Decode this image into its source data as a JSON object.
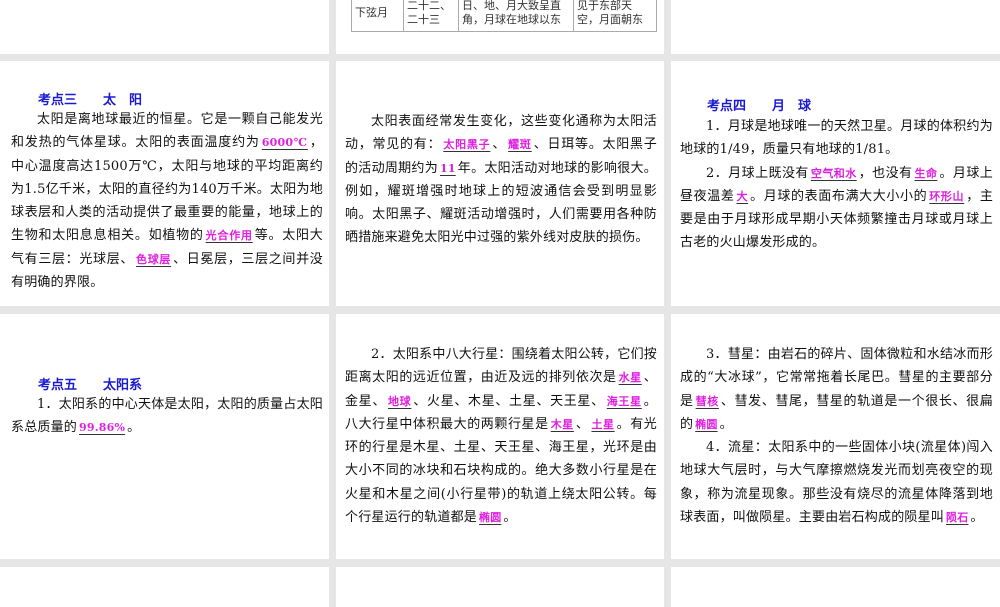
{
  "table_row": {
    "cells": [
      "下弦月",
      "二十二、\n二十三",
      "日、地、月大致呈直角，月球在地球以东",
      "见于东部天空，月面朝东"
    ]
  },
  "slides": {
    "sun": {
      "heading": [
        "考点三",
        "太　阳"
      ],
      "paragraphs": [
        [
          {
            "t": "太阳是离地球最近的恒星。它是一颗自己能发光和发热的气体星球。太阳的表面温度约为"
          },
          {
            "t": "6000℃",
            "hl": true
          },
          {
            "t": "，中心温度高达1500万℃，太阳与地球的平均距离约为1.5亿千米，太阳的直径约为140万千米。太阳为地球表层和人类的活动提供了最重要的能量，地球上的生物和太阳息息相关。如植物的"
          },
          {
            "t": "光合作用",
            "hl": true
          },
          {
            "t": "等。太阳大气有三层：光球层、"
          },
          {
            "t": "色球层",
            "hl": true
          },
          {
            "t": "、日冕层，三层之间并没有明确的界限。"
          }
        ]
      ]
    },
    "solar_activity": {
      "paragraphs": [
        [
          {
            "t": "太阳表面经常发生变化，这些变化通称为太阳活动，常见的有："
          },
          {
            "t": "太阳黑子",
            "hl": true
          },
          {
            "t": "、"
          },
          {
            "t": "耀斑",
            "hl": true
          },
          {
            "t": "、日珥等。太阳黑子的活动周期约为"
          },
          {
            "t": "11",
            "hl": true
          },
          {
            "t": "年。太阳活动对地球的影响很大。例如，耀斑增强时地球上的短波通信会受到明显影响。太阳黑子、耀斑活动增强时，人们需要用各种防晒措施来避免太阳光中过强的紫外线对皮肤的损伤。"
          }
        ]
      ]
    },
    "moon": {
      "heading": [
        "考点四",
        "月　球"
      ],
      "paragraphs": [
        [
          {
            "t": "1．月球是地球唯一的天然卫星。月球的体积约为地球的1/49，质量只有地球的1/81。"
          }
        ],
        [
          {
            "t": "2．月球上既没有"
          },
          {
            "t": "空气和水",
            "hl": true
          },
          {
            "t": "，也没有"
          },
          {
            "t": "生命",
            "hl": true
          },
          {
            "t": "。月球上昼夜温差"
          },
          {
            "t": "大",
            "hl": true
          },
          {
            "t": "。月球的表面布满大大小小的"
          },
          {
            "t": "环形山",
            "hl": true
          },
          {
            "t": "，主要是由于月球形成早期小天体频繁撞击月球或月球上古老的火山爆发形成的。"
          }
        ]
      ]
    },
    "solar_system": {
      "heading": [
        "考点五",
        "太阳系"
      ],
      "paragraphs": [
        [
          {
            "t": "1．太阳系的中心天体是太阳，太阳的质量占太阳系总质量的"
          },
          {
            "t": "99.86%",
            "hl": true
          },
          {
            "t": "。"
          }
        ]
      ]
    },
    "planets": {
      "paragraphs": [
        [
          {
            "t": "2．太阳系中八大行星：围绕着太阳公转，它们按距离太阳的远近位置，由近及远的排列依次是"
          },
          {
            "t": "水星",
            "hl": true
          },
          {
            "t": "、金星、"
          },
          {
            "t": "地球",
            "hl": true
          },
          {
            "t": "、火星、木星、土星、天王星、"
          },
          {
            "t": "海王星",
            "hl": true
          },
          {
            "t": "。八大行星中体积最大的两颗行星是"
          },
          {
            "t": "木星",
            "hl": true
          },
          {
            "t": "、"
          },
          {
            "t": "土星",
            "hl": true
          },
          {
            "t": "。有光环的行星是木星、土星、天王星、海王星，光环是由大小不同的冰块和石块构成的。绝大多数小行星是在火星和木星之间(小行星带)的轨道上绕太阳公转。每个行星运行的轨道都是"
          },
          {
            "t": "椭圆",
            "hl": true
          },
          {
            "t": "。"
          }
        ]
      ]
    },
    "comets": {
      "paragraphs": [
        [
          {
            "t": "3．彗星：由岩石的碎片、固体微粒和水结冰而形成的“大冰球”，它常常拖着长尾巴。彗星的主要部分是"
          },
          {
            "t": "彗核",
            "hl": true
          },
          {
            "t": "、彗发、彗尾，彗星的轨道是一个很长、很扁的"
          },
          {
            "t": "椭圆",
            "hl": true
          },
          {
            "t": "。"
          }
        ],
        [
          {
            "t": "4．流星：太阳系中的一些固体小块(流星体)闯入地球大气层时，与大气摩擦燃烧发光而划亮夜空的现象，称为流星现象。那些没有烧尽的流星体降落到地球表面，叫做陨星。主要由岩石构成的陨星叫"
          },
          {
            "t": "陨石",
            "hl": true
          },
          {
            "t": "。"
          }
        ]
      ]
    }
  }
}
